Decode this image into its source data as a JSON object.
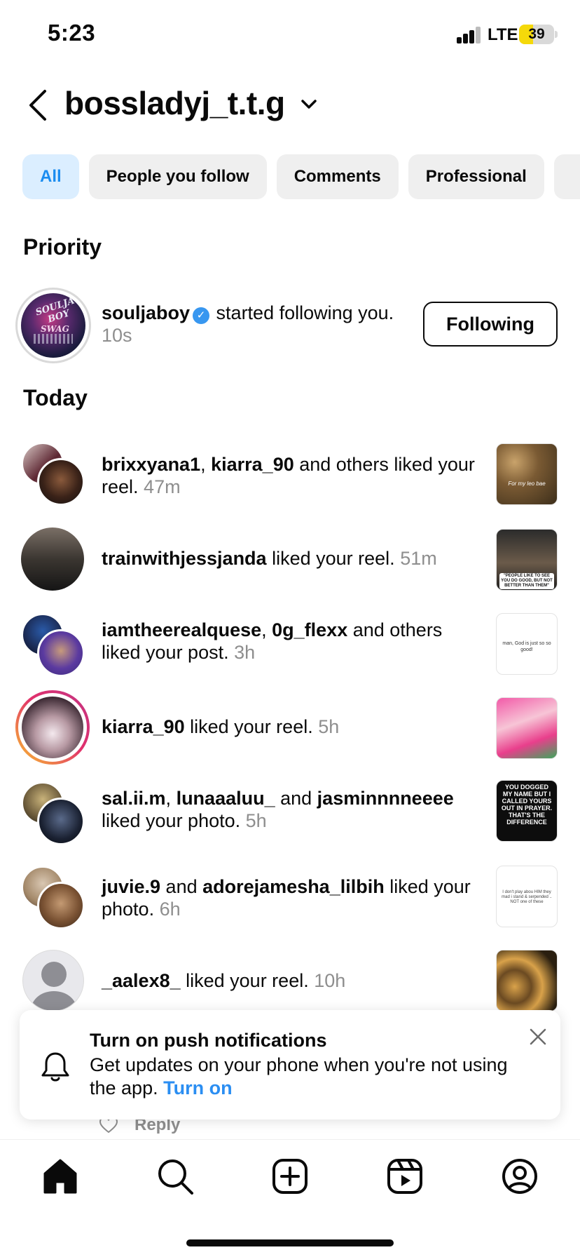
{
  "status_bar": {
    "time": "5:23",
    "network": "LTE",
    "battery_level": "39",
    "battery_fraction": 0.39
  },
  "header": {
    "username": "bossladyj_t.t.g"
  },
  "filters": [
    {
      "label": "All",
      "active": true
    },
    {
      "label": "People you follow",
      "active": false
    },
    {
      "label": "Comments",
      "active": false
    },
    {
      "label": "Professional",
      "active": false
    }
  ],
  "priority": {
    "heading": "Priority",
    "item": {
      "user": "souljaboy",
      "verified": true,
      "action": "started following you.",
      "time": "10s",
      "button": "Following",
      "avatar_text": [
        "SOULJA",
        "BOY",
        "SWAG"
      ]
    }
  },
  "today": {
    "heading": "Today",
    "items": [
      {
        "users": [
          "brixxyana1",
          "kiarra_90"
        ],
        "sep": ", ",
        "tail": " and others liked your reel.",
        "time": "47m",
        "thumb_caption": "For my leo bae"
      },
      {
        "users": [
          "trainwithjessjanda"
        ],
        "tail": " liked your reel.",
        "time": "51m",
        "thumb_caption": "\"PEOPLE LIKE TO SEE YOU DO GOOD, BUT NOT BETTER THAN THEM\""
      },
      {
        "users": [
          "iamtheerealquese",
          "0g_flexx"
        ],
        "sep": ", ",
        "tail": " and others liked your post.",
        "time": "3h",
        "thumb_caption": "man, God is just so so good!"
      },
      {
        "users": [
          "kiarra_90"
        ],
        "tail": " liked your reel.",
        "time": "5h",
        "thumb_caption": ""
      },
      {
        "users": [
          "sal.ii.m",
          "lunaaaluu_",
          "jasminnnneeee"
        ],
        "tail": " liked your photo.",
        "time": "5h",
        "thumb_caption": "YOU DOGGED MY NAME BUT I CALLED YOURS OUT IN PRAYER. THAT'S THE DIFFERENCE"
      },
      {
        "users": [
          "juvie.9",
          "adorejamesha_lilbih"
        ],
        "sep": " and ",
        "tail": " liked your photo.",
        "time": "6h",
        "thumb_caption": "I don't play abou HIM they mad i stand & serpended .. NOT one of these"
      },
      {
        "users": [
          "_aalex8_"
        ],
        "tail": " liked your reel.",
        "time": "10h",
        "thumb_caption": ""
      }
    ]
  },
  "push": {
    "title": "Turn on push notifications",
    "body": "Get updates on your phone when you're not using the app.",
    "link": "Turn on"
  },
  "reply": {
    "label": "Reply"
  },
  "colors": {
    "accent": "#2b8ef2",
    "chip_active_bg": "#dbeeff",
    "muted": "#8e8e8e",
    "verified": "#3897f0",
    "story_ring": [
      "#f9c22e",
      "#e1306c",
      "#c13584"
    ]
  },
  "icons": {
    "tabs": [
      "home-icon",
      "search-icon",
      "create-icon",
      "reels-icon",
      "profile-icon"
    ]
  }
}
